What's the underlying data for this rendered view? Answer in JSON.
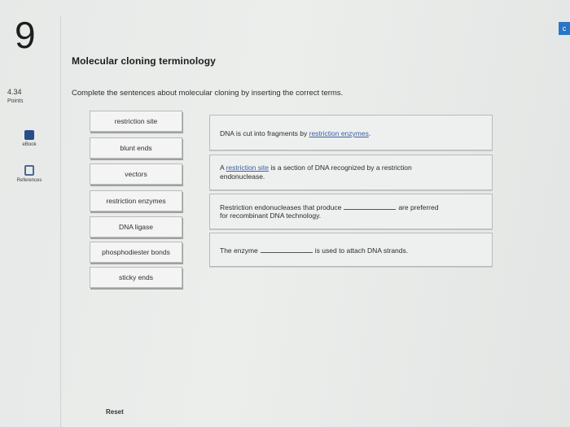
{
  "question": {
    "number": "9",
    "points_value": "4.34",
    "points_label": "Points",
    "title": "Molecular cloning terminology",
    "instructions": "Complete the sentences about molecular cloning by inserting the correct terms."
  },
  "tools": [
    {
      "label": "eBook",
      "icon": "book-icon"
    },
    {
      "label": "References",
      "icon": "references-icon"
    }
  ],
  "corner_tab": "c",
  "terms": [
    "restriction site",
    "blunt ends",
    "vectors",
    "restriction enzymes",
    "DNA ligase",
    "phosphodiester bonds",
    "sticky ends"
  ],
  "sentences": [
    {
      "before": "DNA is cut into fragments by ",
      "filled": "restriction enzymes",
      "after": "."
    },
    {
      "before": "A ",
      "filled": "restriction site",
      "after": " is a section of DNA recognized by a restriction",
      "line2": "endonuclease."
    },
    {
      "before": "Restriction endonucleases that produce",
      "after": "are preferred",
      "line2": "for recombinant DNA technology."
    },
    {
      "before": "The enzyme",
      "after": "is used to attach DNA strands."
    }
  ],
  "reset_label": "Reset",
  "colors": {
    "accent": "#2a76c6",
    "filled_text": "#3a5fa8",
    "ebook_icon": "#274e88"
  }
}
